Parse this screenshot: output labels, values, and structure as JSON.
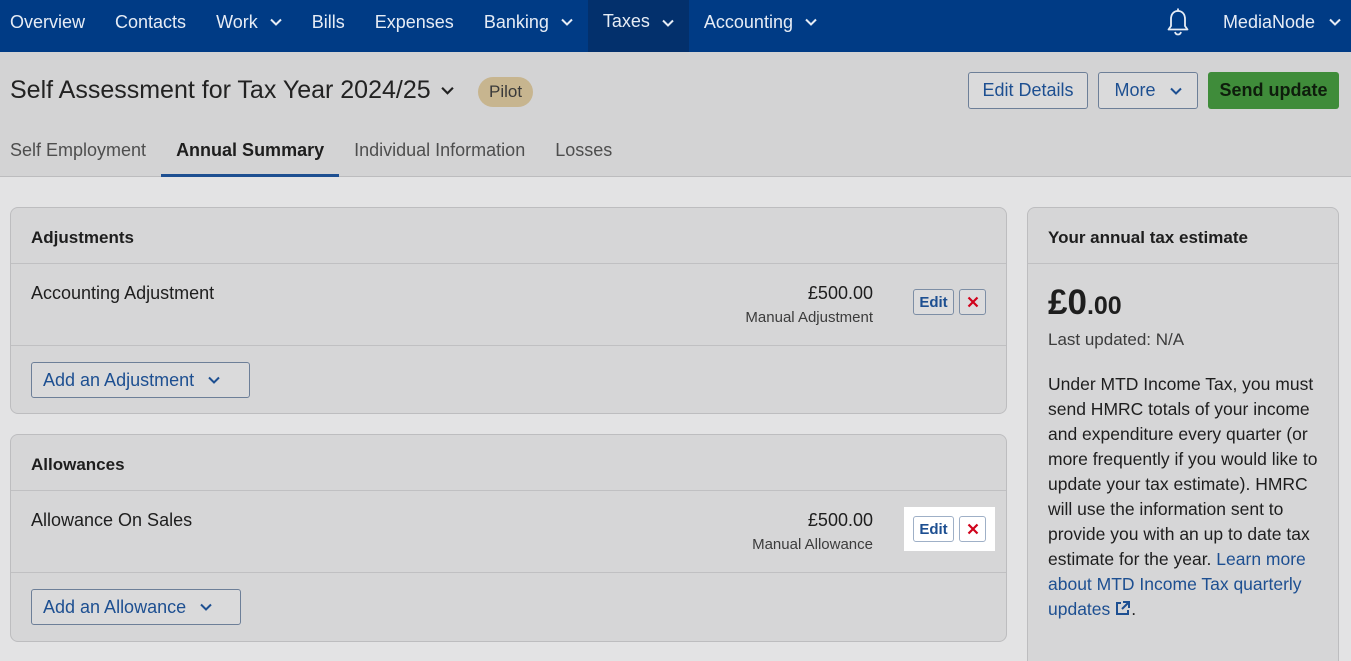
{
  "nav": {
    "items": [
      {
        "label": "Overview",
        "dropdown": false
      },
      {
        "label": "Contacts",
        "dropdown": false
      },
      {
        "label": "Work",
        "dropdown": true
      },
      {
        "label": "Bills",
        "dropdown": false
      },
      {
        "label": "Expenses",
        "dropdown": false
      },
      {
        "label": "Banking",
        "dropdown": true
      },
      {
        "label": "Taxes",
        "dropdown": true,
        "active": true
      },
      {
        "label": "Accounting",
        "dropdown": true
      }
    ],
    "notification_icon": "bell-icon",
    "org_name": "MediaNode"
  },
  "header": {
    "title": "Self Assessment for Tax Year 2024/25",
    "badge": "Pilot",
    "edit_details_label": "Edit Details",
    "more_label": "More",
    "send_update_label": "Send update"
  },
  "tabs": [
    {
      "label": "Self Employment",
      "active": false
    },
    {
      "label": "Annual Summary",
      "active": true
    },
    {
      "label": "Individual Information",
      "active": false
    },
    {
      "label": "Losses",
      "active": false
    }
  ],
  "adjustments": {
    "heading": "Adjustments",
    "rows": [
      {
        "label": "Accounting Adjustment",
        "amount": "£500.00",
        "sub": "Manual Adjustment",
        "edit_label": "Edit"
      }
    ],
    "add_label": "Add an Adjustment"
  },
  "allowances": {
    "heading": "Allowances",
    "rows": [
      {
        "label": "Allowance On Sales",
        "amount": "£500.00",
        "sub": "Manual Allowance",
        "edit_label": "Edit"
      }
    ],
    "add_label": "Add an Allowance"
  },
  "estimate": {
    "heading": "Your annual tax estimate",
    "amount_major": "£0",
    "amount_minor": ".00",
    "last_updated": "Last updated: N/A",
    "body": "Under MTD Income Tax, you must send HMRC totals of your income and expenditure every quarter (or more frequently if you would like to update your tax estimate). HMRC will use the information sent to provide you with an up to date tax estimate for the year.",
    "link": "Learn more about MTD Income Tax quarterly updates",
    "trailing": "."
  },
  "colors": {
    "nav_bg": "#003b85",
    "primary_link": "#1d4f91",
    "send_button": "#3f8c3a",
    "delete_red": "#d0021b"
  }
}
